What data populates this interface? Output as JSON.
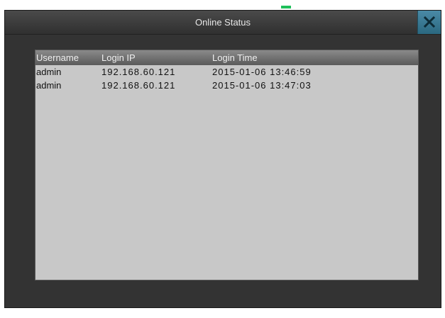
{
  "window": {
    "title": "Online Status",
    "close_icon": "close-icon"
  },
  "table": {
    "columns": [
      "Username",
      "Login IP",
      "Login Time"
    ],
    "rows": [
      [
        "admin",
        "192.168.60.121",
        "2015-01-06 13:46:59"
      ],
      [
        "admin",
        "192.168.60.121",
        "2015-01-06 13:47:03"
      ]
    ]
  },
  "colors": {
    "window_bg": "#333333",
    "table_bg": "#c8c8c8",
    "close_accent": "#2b6880",
    "indicator": "#1fbf5a"
  }
}
